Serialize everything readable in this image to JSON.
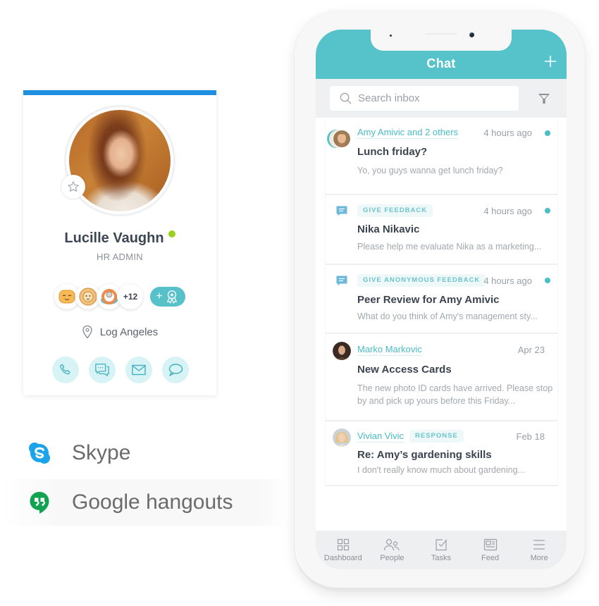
{
  "profile": {
    "name": "Lucille Vaughn",
    "role": "HR ADMIN",
    "status": "online",
    "status_color": "#9bd01b",
    "location": "Log Angeles",
    "badges": [
      {
        "icon": "smiley-badge-icon"
      },
      {
        "icon": "lion-badge-icon"
      },
      {
        "icon": "lifebuoy-badge-icon"
      }
    ],
    "badge_more_count": "+12",
    "award_button": {
      "label": "+",
      "icon": "award-ribbon-icon"
    },
    "actions": [
      {
        "name": "call-button",
        "icon": "phone-icon"
      },
      {
        "name": "group-message-button",
        "icon": "chat-bubbles-icon"
      },
      {
        "name": "email-button",
        "icon": "envelope-icon"
      },
      {
        "name": "message-button",
        "icon": "speech-bubble-icon"
      }
    ],
    "accent_color": "#1f8fe0"
  },
  "integrations": [
    {
      "label": "Skype",
      "icon": "skype-icon",
      "color": "#1ba4ea"
    },
    {
      "label": "Google hangouts",
      "icon": "google-hangouts-icon",
      "color": "#11a34f"
    }
  ],
  "phone": {
    "header": {
      "title": "Chat",
      "add_icon": "plus-icon",
      "color": "#56c3ca"
    },
    "search": {
      "placeholder": "Search inbox",
      "value": ""
    },
    "inbox": [
      {
        "sender": "Amy Amivic and 2 others",
        "time": "4 hours ago",
        "unread": true,
        "subject": "Lunch friday?",
        "preview": "Yo, you guys wanna get lunch friday?"
      },
      {
        "tag": "GIVE FEEDBACK",
        "time": "4 hours ago",
        "unread": true,
        "subject": "Nika Nikavic",
        "preview": "Please help me evaluate Nika as a marketing..."
      },
      {
        "tag": "GIVE ANONYMOUS FEEDBACK",
        "time": "4 hours ago",
        "unread": true,
        "subject": "Peer Review for Amy Amivic",
        "preview": "What do you think of Amy's management  sty..."
      },
      {
        "sender": "Marko Markovic",
        "time": "Apr 23",
        "unread": false,
        "subject": "New Access Cards",
        "preview": "The new photo ID cards have arrived. Please stop by and pick up yours before this Friday..."
      },
      {
        "sender": "Vivian Vivic",
        "tag": "RESPONSE",
        "time": "Feb 18",
        "unread": false,
        "subject": "Re: Amy’s gardening skills",
        "preview": "I don't really know much about gardening..."
      }
    ],
    "nav": [
      {
        "label": "Dashboard",
        "icon": "grid-icon"
      },
      {
        "label": "People",
        "icon": "people-icon"
      },
      {
        "label": "Tasks",
        "icon": "task-check-icon"
      },
      {
        "label": "Feed",
        "icon": "newspaper-icon"
      },
      {
        "label": "More",
        "icon": "menu-icon"
      }
    ]
  }
}
